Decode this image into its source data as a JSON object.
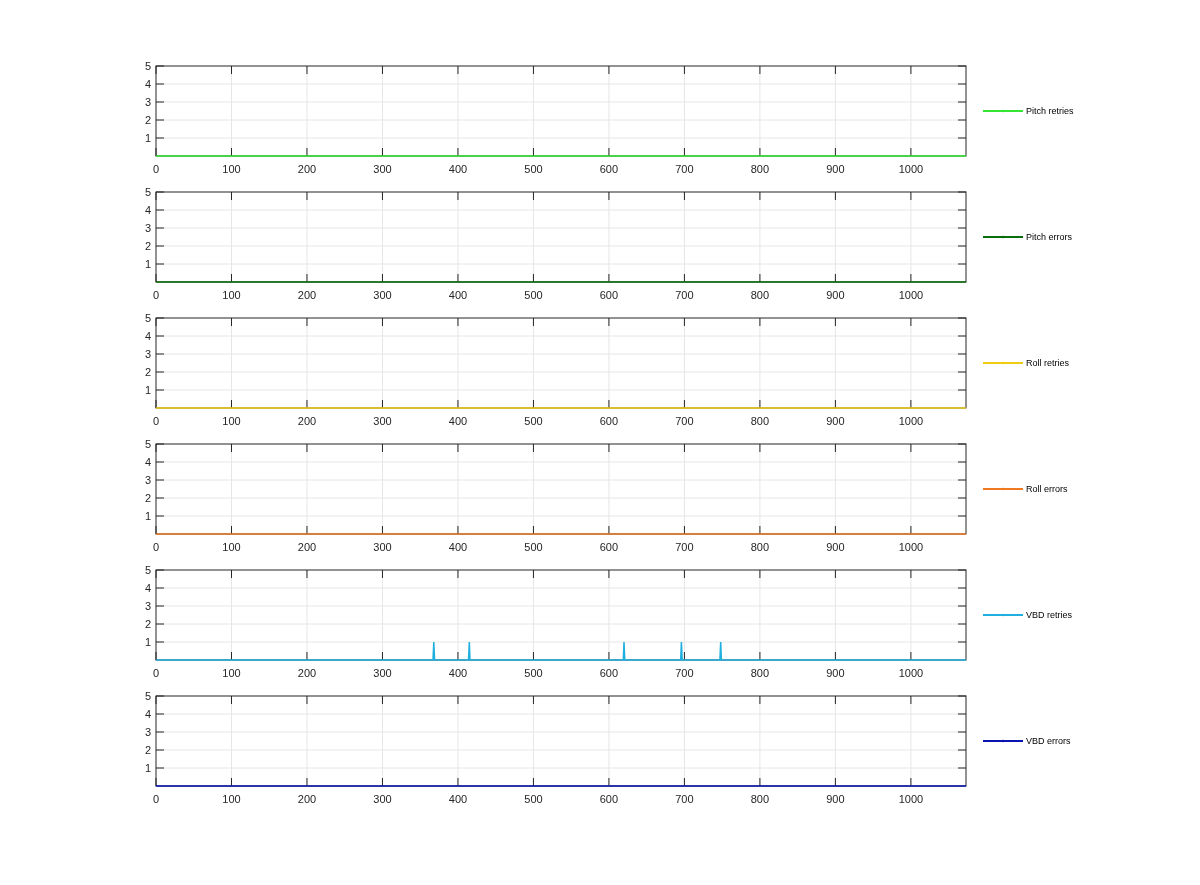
{
  "subplots": [
    {
      "chart_data": {
        "type": "line",
        "grid": true,
        "xlim": [
          0,
          1073
        ],
        "ylim": [
          0,
          5
        ],
        "xticks": [
          0,
          100,
          200,
          300,
          400,
          500,
          600,
          700,
          800,
          900,
          1000
        ],
        "yticks": [
          1,
          2,
          3,
          4,
          5
        ],
        "x": [
          0,
          1073
        ],
        "series": [
          {
            "name": "Pitch retries",
            "color": "#33e633",
            "values": [
              0,
              0
            ]
          }
        ]
      }
    },
    {
      "chart_data": {
        "type": "line",
        "grid": true,
        "xlim": [
          0,
          1073
        ],
        "ylim": [
          0,
          5
        ],
        "xticks": [
          0,
          100,
          200,
          300,
          400,
          500,
          600,
          700,
          800,
          900,
          1000
        ],
        "yticks": [
          1,
          2,
          3,
          4,
          5
        ],
        "x": [
          0,
          1073
        ],
        "series": [
          {
            "name": "Pitch errors",
            "color": "#0a6e0a",
            "values": [
              0,
              0
            ]
          }
        ]
      }
    },
    {
      "chart_data": {
        "type": "line",
        "grid": true,
        "xlim": [
          0,
          1073
        ],
        "ylim": [
          0,
          5
        ],
        "xticks": [
          0,
          100,
          200,
          300,
          400,
          500,
          600,
          700,
          800,
          900,
          1000
        ],
        "yticks": [
          1,
          2,
          3,
          4,
          5
        ],
        "x": [
          0,
          1073
        ],
        "series": [
          {
            "name": "Roll retries",
            "color": "#f0cc10",
            "values": [
              0,
              0
            ]
          }
        ]
      }
    },
    {
      "chart_data": {
        "type": "line",
        "grid": true,
        "xlim": [
          0,
          1073
        ],
        "ylim": [
          0,
          5
        ],
        "xticks": [
          0,
          100,
          200,
          300,
          400,
          500,
          600,
          700,
          800,
          900,
          1000
        ],
        "yticks": [
          1,
          2,
          3,
          4,
          5
        ],
        "x": [
          0,
          1073
        ],
        "series": [
          {
            "name": "Roll errors",
            "color": "#f07820",
            "values": [
              0,
              0
            ]
          }
        ]
      }
    },
    {
      "chart_data": {
        "type": "line",
        "grid": true,
        "xlim": [
          0,
          1073
        ],
        "ylim": [
          0,
          5
        ],
        "xticks": [
          0,
          100,
          200,
          300,
          400,
          500,
          600,
          700,
          800,
          900,
          1000
        ],
        "yticks": [
          1,
          2,
          3,
          4,
          5
        ],
        "x": [
          0,
          367,
          368,
          369,
          414,
          415,
          416,
          619,
          620,
          621,
          695,
          696,
          697,
          747,
          748,
          749,
          1073
        ],
        "series": [
          {
            "name": "VBD retries",
            "color": "#20b0e0",
            "values": [
              0,
              0,
              1,
              0,
              0,
              1,
              0,
              0,
              1,
              0,
              0,
              1,
              0,
              0,
              1,
              0,
              0
            ]
          }
        ]
      }
    },
    {
      "chart_data": {
        "type": "line",
        "grid": true,
        "xlim": [
          0,
          1073
        ],
        "ylim": [
          0,
          5
        ],
        "xticks": [
          0,
          100,
          200,
          300,
          400,
          500,
          600,
          700,
          800,
          900,
          1000
        ],
        "yticks": [
          1,
          2,
          3,
          4,
          5
        ],
        "x": [
          0,
          1073
        ],
        "series": [
          {
            "name": "VBD errors",
            "color": "#0a14b4",
            "values": [
              0,
              0
            ]
          }
        ]
      }
    }
  ]
}
